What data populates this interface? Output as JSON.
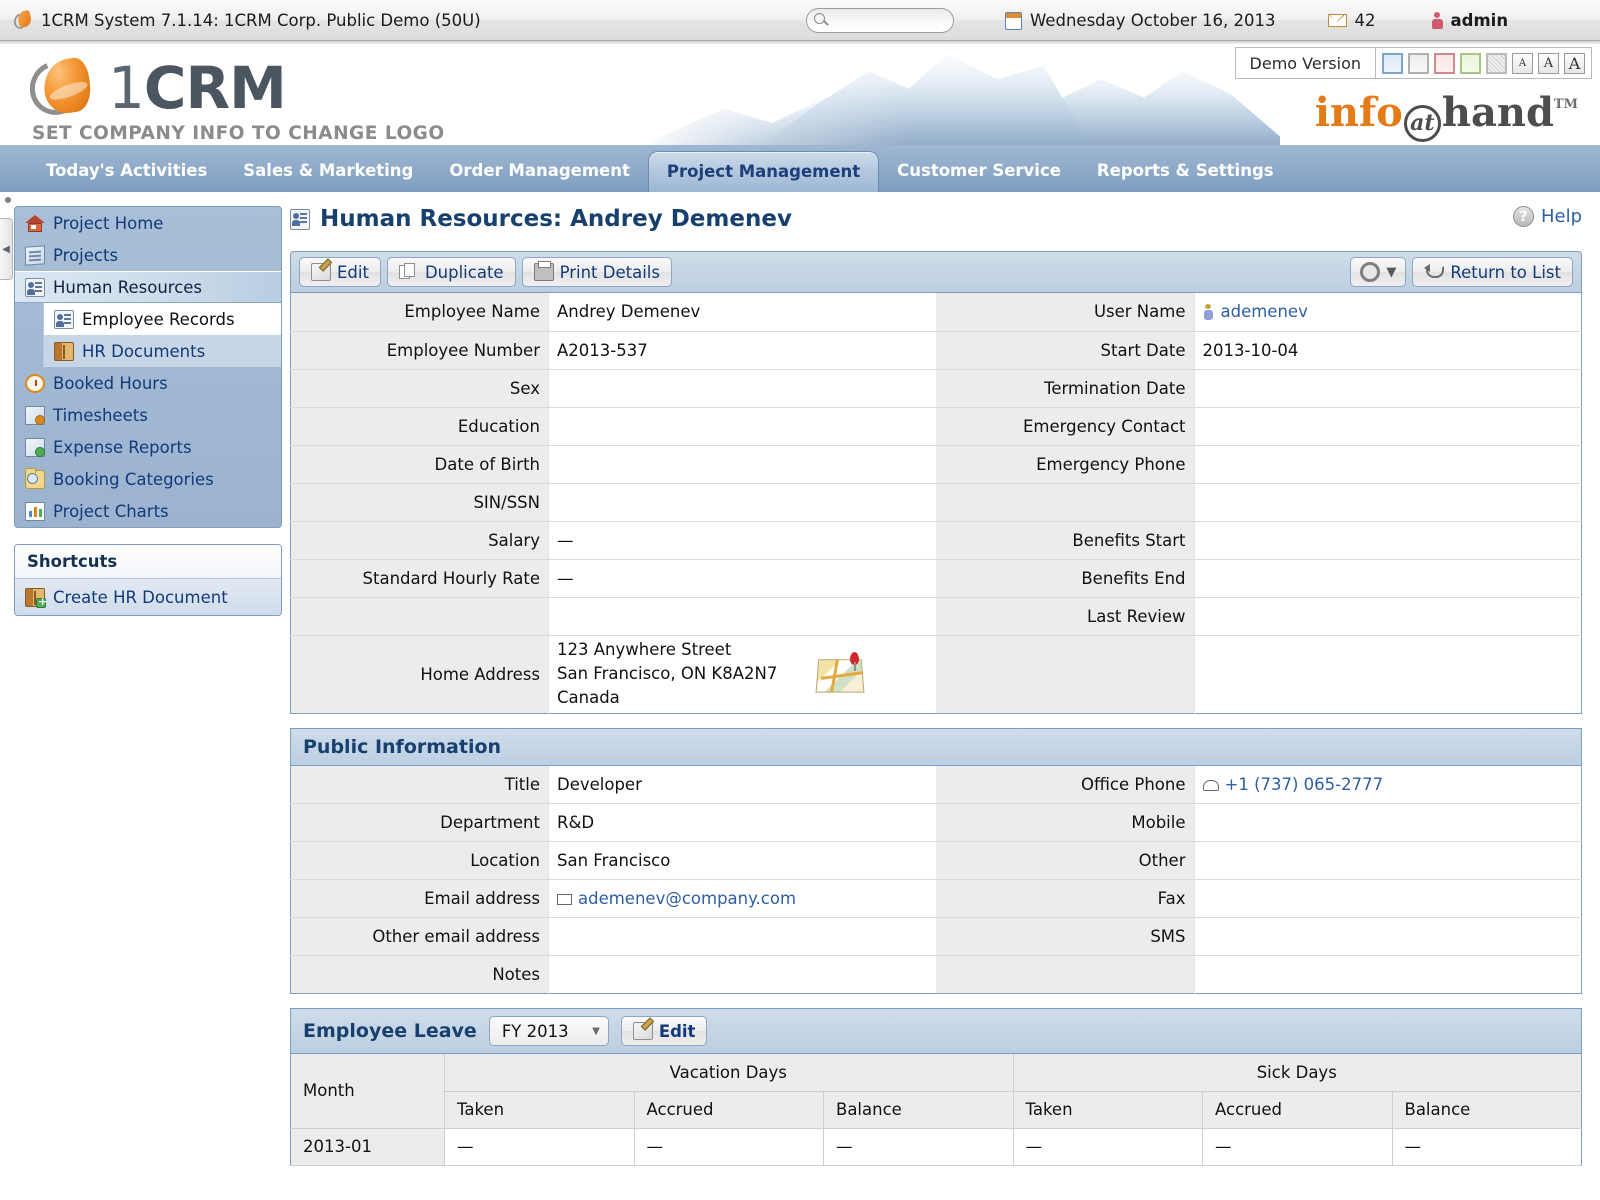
{
  "topbar": {
    "app_icon": "1crm-drop-icon",
    "title": "1CRM System 7.1.14: 1CRM Corp. Public Demo (50U)",
    "search_placeholder": "",
    "search_value": "",
    "date": "Wednesday October 16, 2013",
    "mail_count": "42",
    "user": "admin"
  },
  "header": {
    "logo_one": "1",
    "logo_crm": "CRM",
    "logo_subtitle": "SET COMPANY INFO TO CHANGE LOGO",
    "demo_label": "Demo Version",
    "theme_swatches": [
      "blue-theme-swatch",
      "gray-theme-swatch",
      "red-theme-swatch",
      "green-theme-swatch",
      "texture-theme-swatch"
    ],
    "font_sizes": [
      "A",
      "A",
      "A"
    ],
    "brand_info": "info",
    "brand_at": "at",
    "brand_hand": "hand",
    "brand_tm": "TM"
  },
  "nav": {
    "tabs": [
      {
        "label": "Today's Activities",
        "active": false
      },
      {
        "label": "Sales & Marketing",
        "active": false
      },
      {
        "label": "Order Management",
        "active": false
      },
      {
        "label": "Project Management",
        "active": true
      },
      {
        "label": "Customer Service",
        "active": false
      },
      {
        "label": "Reports & Settings",
        "active": false
      }
    ]
  },
  "sidebar": {
    "items": [
      {
        "label": "Project Home",
        "icon": "home-icon"
      },
      {
        "label": "Projects",
        "icon": "document-icon"
      },
      {
        "label": "Human Resources",
        "icon": "id-badge-icon"
      },
      {
        "label": "Booked Hours",
        "icon": "clock-icon"
      },
      {
        "label": "Timesheets",
        "icon": "timesheet-icon"
      },
      {
        "label": "Expense Reports",
        "icon": "money-sheet-icon"
      },
      {
        "label": "Booking Categories",
        "icon": "folder-search-icon"
      },
      {
        "label": "Project Charts",
        "icon": "chart-icon"
      }
    ],
    "subitems": [
      {
        "label": "Employee Records",
        "icon": "id-badge-icon"
      },
      {
        "label": "HR Documents",
        "icon": "book-icon"
      }
    ],
    "shortcuts_title": "Shortcuts",
    "shortcuts": [
      {
        "label": "Create HR Document",
        "icon": "book-plus-icon"
      }
    ]
  },
  "main": {
    "page_title": "Human Resources: Andrey Demenev",
    "help_label": "Help",
    "toolbar": {
      "edit": "Edit",
      "duplicate": "Duplicate",
      "print_details": "Print Details",
      "return_to_list": "Return to List"
    },
    "details": {
      "rows": [
        {
          "l_label": "Employee Name",
          "l_value": "Andrey Demenev",
          "r_label": "User Name",
          "r_value": "ademenev",
          "r_link": true,
          "r_icon": "user-icon"
        },
        {
          "l_label": "Employee Number",
          "l_value": "A2013-537",
          "r_label": "Start Date",
          "r_value": "2013-10-04"
        },
        {
          "l_label": "Sex",
          "l_value": "",
          "r_label": "Termination Date",
          "r_value": ""
        },
        {
          "l_label": "Education",
          "l_value": "",
          "r_label": "Emergency Contact",
          "r_value": ""
        },
        {
          "l_label": "Date of Birth",
          "l_value": "",
          "r_label": "Emergency Phone",
          "r_value": ""
        },
        {
          "l_label": "SIN/SSN",
          "l_value": "",
          "r_label": "",
          "r_value": ""
        },
        {
          "l_label": "Salary",
          "l_value": "—",
          "r_label": "Benefits Start",
          "r_value": ""
        },
        {
          "l_label": "Standard Hourly Rate",
          "l_value": "—",
          "r_label": "Benefits End",
          "r_value": ""
        },
        {
          "l_label": "",
          "l_value": "",
          "r_label": "Last Review",
          "r_value": ""
        }
      ],
      "home_address_label": "Home Address",
      "home_address_line1": "123 Anywhere Street",
      "home_address_line2": "San Francisco, ON  K8A2N7",
      "home_address_line3": "Canada",
      "map_icon": "map-pin-icon"
    },
    "public_info": {
      "title": "Public Information",
      "rows": [
        {
          "l_label": "Title",
          "l_value": "Developer",
          "r_label": "Office Phone",
          "r_value": "+1 (737) 065-2777",
          "r_link": true,
          "r_icon": "phone-icon"
        },
        {
          "l_label": "Department",
          "l_value": "R&D",
          "r_label": "Mobile",
          "r_value": ""
        },
        {
          "l_label": "Location",
          "l_value": "San Francisco",
          "r_label": "Other",
          "r_value": ""
        },
        {
          "l_label": "Email address",
          "l_value": "ademenev@company.com",
          "l_link": true,
          "l_icon": "envelope-icon",
          "r_label": "Fax",
          "r_value": ""
        },
        {
          "l_label": "Other email address",
          "l_value": "",
          "r_label": "SMS",
          "r_value": ""
        },
        {
          "l_label": "Notes",
          "l_value": "",
          "r_label": "",
          "r_value": ""
        }
      ]
    },
    "employee_leave": {
      "title": "Employee Leave",
      "fiscal_year": "FY 2013",
      "edit_label": "Edit",
      "month_header": "Month",
      "groups": [
        "Vacation Days",
        "Sick Days"
      ],
      "sub_headers": [
        "Taken",
        "Accrued",
        "Balance"
      ],
      "rows": [
        {
          "month": "2013-01",
          "vacation_taken": "—",
          "vacation_accrued": "—",
          "vacation_balance": "—",
          "sick_taken": "—",
          "sick_accrued": "—",
          "sick_balance": "—"
        }
      ]
    }
  }
}
